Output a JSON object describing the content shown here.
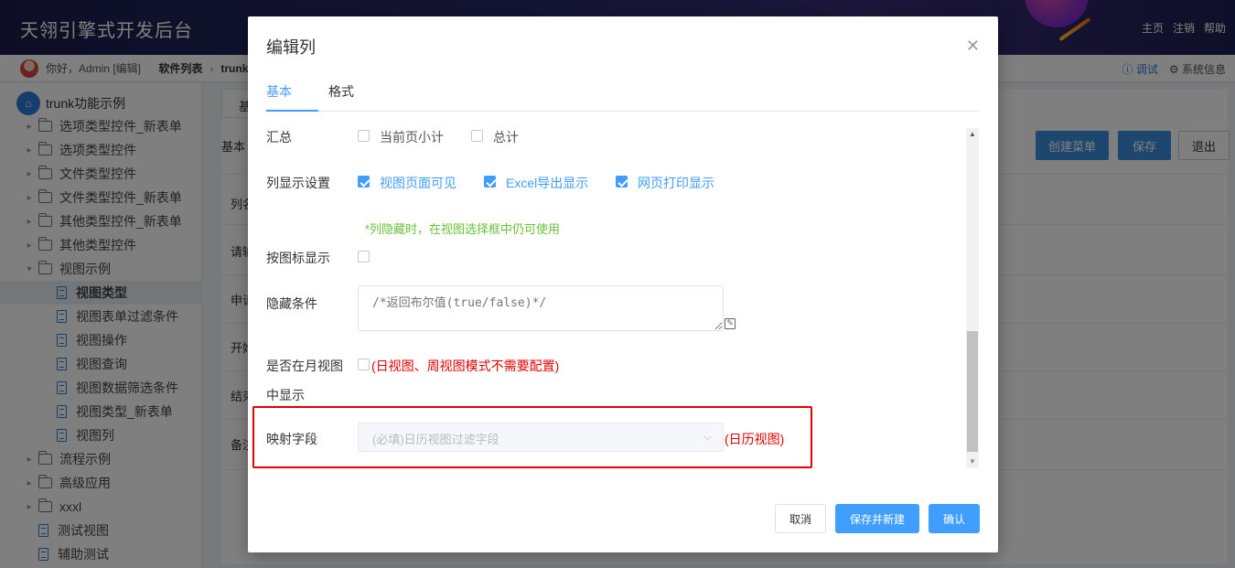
{
  "header": {
    "app_title": "天翎引擎式开发后台",
    "links": [
      "主页",
      "注销",
      "帮助"
    ]
  },
  "subbar": {
    "greeting": "你好，Admin [编辑]",
    "crumb1": "软件列表",
    "crumb2": "trunk",
    "debug": "调试",
    "sysinfo": "系统信息"
  },
  "sidebar": {
    "root": "trunk功能示例",
    "items": [
      {
        "label": "选项类型控件_新表单",
        "kind": "folder",
        "caret": "▸"
      },
      {
        "label": "选项类型控件",
        "kind": "folder",
        "caret": "▸"
      },
      {
        "label": "文件类型控件",
        "kind": "folder",
        "caret": "▸"
      },
      {
        "label": "文件类型控件_新表单",
        "kind": "folder",
        "caret": "▸"
      },
      {
        "label": "其他类型控件_新表单",
        "kind": "folder",
        "caret": "▸"
      },
      {
        "label": "其他类型控件",
        "kind": "folder",
        "caret": "▸"
      },
      {
        "label": "视图示例",
        "kind": "folder-open",
        "caret": "▾"
      },
      {
        "label": "视图类型",
        "kind": "doc",
        "active": true
      },
      {
        "label": "视图表单过滤条件",
        "kind": "doc"
      },
      {
        "label": "视图操作",
        "kind": "doc"
      },
      {
        "label": "视图查询",
        "kind": "doc"
      },
      {
        "label": "视图数据筛选条件",
        "kind": "doc"
      },
      {
        "label": "视图类型_新表单",
        "kind": "doc"
      },
      {
        "label": "视图列",
        "kind": "doc"
      },
      {
        "label": "流程示例",
        "kind": "folder",
        "caret": "▸"
      },
      {
        "label": "高级应用",
        "kind": "folder",
        "caret": "▸"
      },
      {
        "label": "xxxl",
        "kind": "folder",
        "caret": "▸"
      },
      {
        "label": "测试视图",
        "kind": "doc-root"
      },
      {
        "label": "辅助测试",
        "kind": "doc-root"
      }
    ]
  },
  "background": {
    "tab": "基",
    "section": "基本",
    "row_labels": [
      "列名",
      "请输",
      "申请",
      "开始",
      "结束",
      "备注"
    ],
    "buttons": {
      "create_menu": "创建菜单",
      "save": "保存",
      "exit": "退出"
    }
  },
  "modal": {
    "title": "编辑列",
    "tabs": [
      "基本",
      "格式"
    ],
    "summary_label": "汇总",
    "summary_opts": [
      "当前页小计",
      "总计"
    ],
    "display_label": "列显示设置",
    "display_opts": [
      "视图页面可见",
      "Excel导出显示",
      "网页打印显示"
    ],
    "hidden_hint": "*列隐藏时，在视图选择框中仍可使用",
    "icon_display_label": "按图标显示",
    "hide_cond_label": "隐藏条件",
    "hide_cond_placeholder": "/*返回布尔值(true/false)*/",
    "month_view_label1": "是否在月视图",
    "month_view_label2": "中显示",
    "month_view_note": "(日视图、周视图模式不需要配置)",
    "map_field_label": "映射字段",
    "map_field_placeholder": "(必填)日历视图过滤字段",
    "map_field_note": "(日历视图)",
    "footer": {
      "cancel": "取消",
      "save_new": "保存并新建",
      "confirm": "确认"
    }
  },
  "colors": {
    "primary": "#409eff",
    "alert_red": "#e60000",
    "hint_green": "#67c23a"
  }
}
